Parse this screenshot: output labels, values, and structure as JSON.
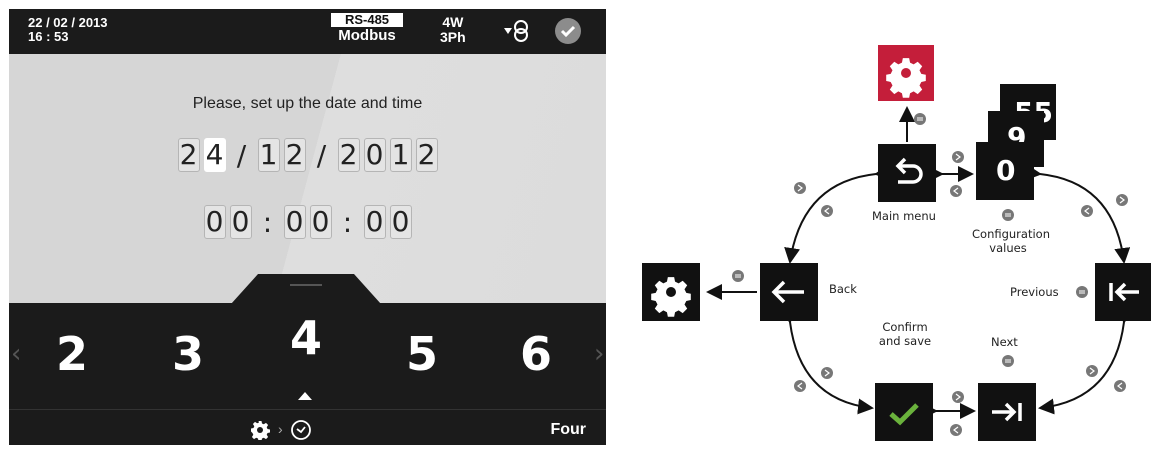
{
  "status_bar": {
    "date": "22 / 02 / 2013",
    "time": "16 : 53",
    "bus_type": "RS-485",
    "protocol": "Modbus",
    "wiring": "4W",
    "phases": "3Ph"
  },
  "screen": {
    "prompt": "Please, set up the date and time",
    "date_digits": [
      "2",
      "4",
      "1",
      "2",
      "2",
      "0",
      "1",
      "2"
    ],
    "date_separators": [
      "/",
      "/"
    ],
    "time_digits": [
      "0",
      "0",
      "0",
      "0",
      "0",
      "0"
    ],
    "time_separators": [
      ":",
      ":"
    ],
    "active_digit_index": 1
  },
  "picker": {
    "values": [
      "2",
      "3",
      "4",
      "5",
      "6"
    ],
    "selected": "4"
  },
  "bottom_bar": {
    "label": "Four"
  },
  "diagram": {
    "labels": {
      "main_menu": "Main menu",
      "config_values_line1": "Configuration",
      "config_values_line2": "values",
      "back": "Back",
      "previous": "Previous",
      "confirm_line1": "Confirm",
      "confirm_line2": "and save",
      "next": "Next"
    },
    "config_stack_values": [
      "55",
      "9",
      "0"
    ],
    "colors": {
      "settings_red": "#c41e3a",
      "confirm_green": "#6ab23c",
      "node_gray": "#777777"
    },
    "icons": [
      "settings-gear-icon",
      "return-icon",
      "back-arrow-icon",
      "previous-icon",
      "checkmark-icon",
      "next-icon"
    ]
  }
}
